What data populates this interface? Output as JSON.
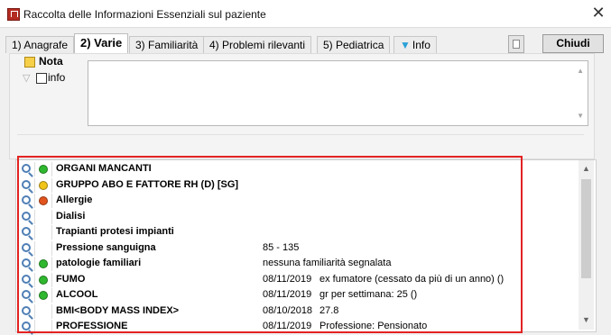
{
  "window": {
    "title": "Raccolta delle Informazioni Essenziali sul paziente"
  },
  "tabs": [
    {
      "label": "1) Anagrafe"
    },
    {
      "label": "2) Varie"
    },
    {
      "label": "3) Familiarità"
    },
    {
      "label": "4) Problemi rilevanti"
    },
    {
      "label": "5) Pediatrica"
    },
    {
      "label": "Info"
    }
  ],
  "toolbar": {
    "close_label": "Chiudi"
  },
  "note": {
    "header": "Nota",
    "info_checkbox_label": "info",
    "info_checked": false,
    "text": ""
  },
  "status_colors": {
    "green": "#2fb82f",
    "yellow": "#f0c419",
    "red": "#e2541e"
  },
  "rows": [
    {
      "label": "ORGANI MANCANTI",
      "status": "green",
      "date": "",
      "desc": ""
    },
    {
      "label": "GRUPPO ABO E FATTORE RH (D) [SG]",
      "status": "yellow",
      "date": "",
      "desc": ""
    },
    {
      "label": "Allergie",
      "status": "red",
      "date": "",
      "desc": ""
    },
    {
      "label": "Dialisi",
      "status": "",
      "date": "",
      "desc": ""
    },
    {
      "label": "Trapianti protesi impianti",
      "status": "",
      "date": "",
      "desc": ""
    },
    {
      "label": "Pressione sanguigna",
      "status": "",
      "value": "85 - 135"
    },
    {
      "label": "patologie familiari",
      "status": "green",
      "value": "nessuna familiarità segnalata"
    },
    {
      "label": "FUMO",
      "status": "green",
      "date": "08/11/2019",
      "desc": "ex fumatore (cessato da più di un anno) ()"
    },
    {
      "label": "ALCOOL",
      "status": "green",
      "date": "08/11/2019",
      "desc": "gr per settimana: 25 ()"
    },
    {
      "label": "BMI<BODY MASS INDEX>",
      "status": "",
      "date": "08/10/2018",
      "desc": "27.8"
    },
    {
      "label": "PROFESSIONE",
      "status": "",
      "date": "08/11/2019",
      "desc": "  Professione: Pensionato"
    }
  ]
}
